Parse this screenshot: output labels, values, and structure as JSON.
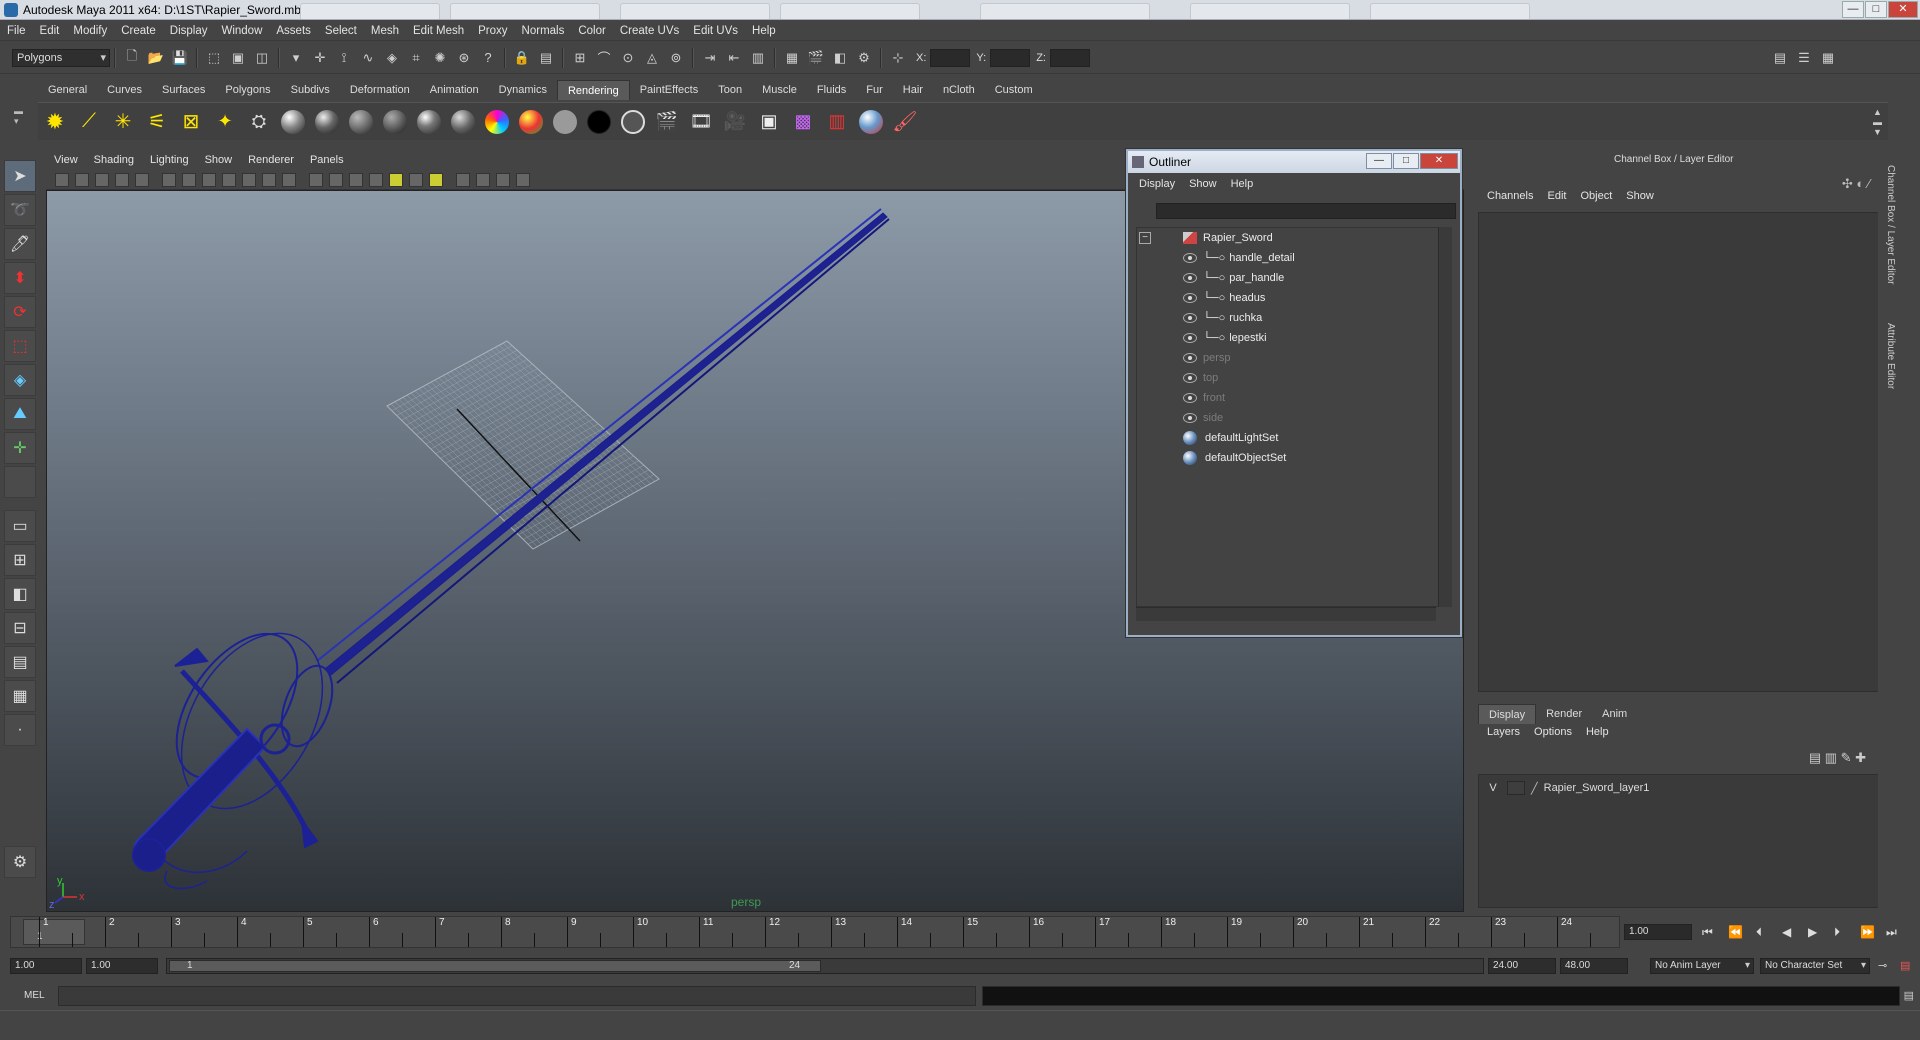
{
  "window": {
    "title": "Autodesk Maya 2011 x64: D:\\1ST\\Rapier_Sword.mb*",
    "min": "—",
    "max": "□",
    "close": "✕"
  },
  "menubar": [
    "File",
    "Edit",
    "Modify",
    "Create",
    "Display",
    "Window",
    "Assets",
    "Select",
    "Mesh",
    "Edit Mesh",
    "Proxy",
    "Normals",
    "Color",
    "Create UVs",
    "Edit UVs",
    "Help"
  ],
  "status": {
    "mode": "Polygons",
    "x_label": "X:",
    "y_label": "Y:",
    "z_label": "Z:"
  },
  "shelf_tabs": [
    "General",
    "Curves",
    "Surfaces",
    "Polygons",
    "Subdivs",
    "Deformation",
    "Animation",
    "Dynamics",
    "Rendering",
    "PaintEffects",
    "Toon",
    "Muscle",
    "Fluids",
    "Fur",
    "Hair",
    "nCloth",
    "Custom"
  ],
  "shelf_active": "Rendering",
  "viewport_menu": [
    "View",
    "Shading",
    "Lighting",
    "Show",
    "Renderer",
    "Panels"
  ],
  "viewport_label": "persp",
  "axis": {
    "x": "x",
    "y": "y",
    "z": "z"
  },
  "outliner": {
    "title": "Outliner",
    "menu": [
      "Display",
      "Show",
      "Help"
    ],
    "items": [
      {
        "name": "Rapier_Sword",
        "dim": false
      },
      {
        "name": "handle_detail",
        "dim": false
      },
      {
        "name": "par_handle",
        "dim": false
      },
      {
        "name": "headus",
        "dim": false
      },
      {
        "name": "ruchka",
        "dim": false
      },
      {
        "name": "lepestki",
        "dim": false
      },
      {
        "name": "persp",
        "dim": true
      },
      {
        "name": "top",
        "dim": true
      },
      {
        "name": "front",
        "dim": true
      },
      {
        "name": "side",
        "dim": true
      },
      {
        "name": "defaultLightSet",
        "dim": false
      },
      {
        "name": "defaultObjectSet",
        "dim": false
      }
    ],
    "expander": "−"
  },
  "channelbox": {
    "title": "Channel Box / Layer Editor",
    "menu": [
      "Channels",
      "Edit",
      "Object",
      "Show"
    ],
    "layer_tabs": [
      "Display",
      "Render",
      "Anim"
    ],
    "layer_menu": [
      "Layers",
      "Options",
      "Help"
    ],
    "layer": {
      "visible": "V",
      "name": "Rapier_Sword_layer1"
    },
    "side_tabs": [
      "Channel Box / Layer Editor",
      "Attribute Editor"
    ]
  },
  "timeline": {
    "ticks": [
      "1",
      "2",
      "3",
      "4",
      "5",
      "6",
      "7",
      "8",
      "9",
      "10",
      "11",
      "12",
      "13",
      "14",
      "15",
      "16",
      "17",
      "18",
      "19",
      "20",
      "21",
      "22",
      "23",
      "24"
    ],
    "current_frame_label": "1",
    "current": "1.00"
  },
  "range": {
    "start": "1.00",
    "start2": "1.00",
    "slider_start": "1",
    "slider_end": "24",
    "end": "24.00",
    "end2": "48.00",
    "anim_layer": "No Anim Layer",
    "char_set": "No Character Set"
  },
  "cmd": {
    "label": "MEL"
  },
  "colors": {
    "bg": "#444444",
    "wire": "#1a1f8c",
    "outliner_frame": "#9bb0c7"
  }
}
